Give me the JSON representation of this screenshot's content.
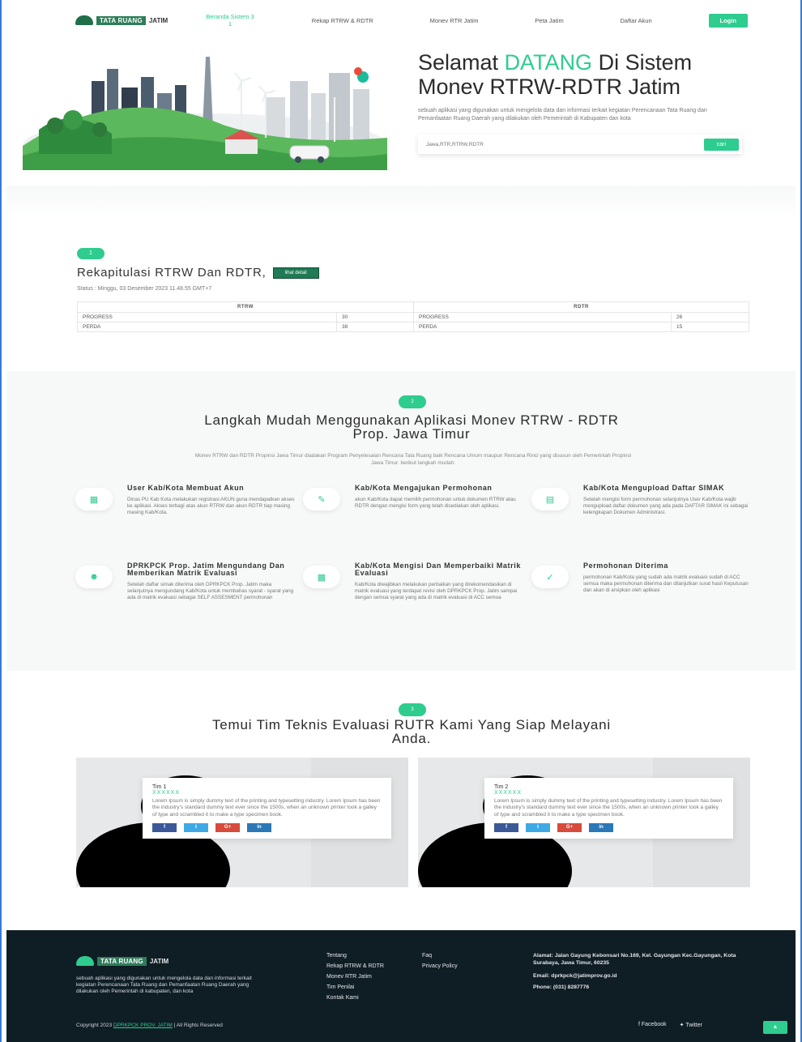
{
  "nav": {
    "logo_text": "TATA RUANG",
    "logo_sub": "JATIM",
    "links": [
      {
        "label": "Beranda Sistem 3 1",
        "active": true
      },
      {
        "label": "Rekap RTRW & RDTR",
        "active": false
      },
      {
        "label": "Monev RTR Jatim",
        "active": false
      },
      {
        "label": "Peta Jatim",
        "active": false
      },
      {
        "label": "Daftar Akun",
        "active": false
      }
    ],
    "login": "Login"
  },
  "hero": {
    "title_pre": "Selamat ",
    "title_accent": "DATANG",
    "title_post": " Di Sistem Monev RTRW-RDTR Jatim",
    "desc": "sebuah aplikasi yang digunakan untuk mengelola data dan informasi terkait kegiatan Perencanaan Tata Ruang dan Pemanfaatan Ruang Daerah yang dilakukan oleh Pemerintah di Kabupaten dan kota",
    "search_placeholder": "Jawa,RTR,RTRW,RDTR",
    "search_button": "cari"
  },
  "rekap": {
    "pill": "1",
    "title": "Rekapitulasi RTRW Dan RDTR,",
    "detail_button": "lihat detail",
    "status": "Status : Minggu, 03 Desember 2023 11.48.55 GMT+7",
    "col_rtrw": "RTRW",
    "col_rdtr": "RDTR",
    "rows": [
      {
        "label_l": "PROGRESS",
        "val_l": "30",
        "label_r": "PROGRESS",
        "val_r": "26"
      },
      {
        "label_l": "PERDA",
        "val_l": "38",
        "label_r": "PERDA",
        "val_r": "15"
      }
    ]
  },
  "langkah": {
    "pill": "2",
    "title": "Langkah Mudah Menggunakan Aplikasi Monev RTRW - RDTR Prop. Jawa Timur",
    "desc": "Monev RTRW dan RDTR Propinsi Jawa Timur diadakan Program Penyelesaian Rencana Tata Ruang baik Rencana Umum maupun Rencana Rinci yang disusun oleh Pemerintah Propinsi Jawa Timur. berikut langkah mudah:",
    "steps": [
      {
        "icon": "user-icon",
        "title": "User Kab/Kota Membuat Akun",
        "desc": "Dinas PU Kab Kota melakukan registrasi AKUN guna mendapatkan akses ke aplikasi. Akses terbagi atas akun RTRW dan akun RDTR tiap masing masing Kab/Kota."
      },
      {
        "icon": "document-icon",
        "title": "Kab/Kota Mengajukan Permohonan",
        "desc": "akun Kab/Kota dapat memilih permohonan untuk dokumen RTRW atau RDTR dengan mengisi form yang telah disediakan oleh aplikasi."
      },
      {
        "icon": "upload-icon",
        "title": "Kab/Kota Mengupload Daftar SIMAK",
        "desc": "Setelah mengisi form permohonan selanjutnya User Kab/Kota wajib mengupload daftar dokumen yang ada pada DAFTAR SIMAK ini sebagai kelengkapan Dokumen Administrasi."
      },
      {
        "icon": "people-icon",
        "title": "DPRKPCK Prop. Jatim Mengundang Dan Memberikan Matrik Evaluasi",
        "desc": "Setelah daftar simak diterima oleh DPRKPCK Prop. Jatim maka selanjutnya mengundang Kab/Kota untuk membahas syarat - syarat yang ada di matrik evaluasi sebagai SELF ASSESMENT permohonan"
      },
      {
        "icon": "form-icon",
        "title": "Kab/Kota Mengisi Dan Memperbaiki Matrik Evaluasi",
        "desc": "Kab/Kota diwajibkan melakukan perbaikan yang direkomendasikan di matrik evaluasi yang terdapat revisi oleh DPRKPCK Prop. Jatim sampai dengan semua syarat yang ada di matrik evaluasi di ACC semua"
      },
      {
        "icon": "check-icon",
        "title": "Permohonan Diterima",
        "desc": "permohonan Kab/Kota yang sudah ada matrik evaluasi sudah di ACC semua maka permohonan diterima dan dilanjutkan surat hasil Keputusan dan akan di arsipkan oleh aplikasi"
      }
    ]
  },
  "team": {
    "pill": "3",
    "title": "Temui Tim Teknis Evaluasi RUTR Kami Yang Siap Melayani Anda.",
    "members": [
      {
        "name": "Tim 1",
        "sub": "XXXXXX",
        "desc": "Lorem Ipsum is simply dummy text of the printing and typesetting industry. Lorem Ipsum has been the industry's standard dummy text ever since the 1500s, when an unknown printer took a galley of type and scrambled it to make a type specimen book."
      },
      {
        "name": "Tim 2",
        "sub": "XXXXXX",
        "desc": "Lorem Ipsum is simply dummy text of the printing and typesetting industry. Lorem Ipsum has been the industry's standard dummy text ever since the 1500s, when an unknown printer took a galley of type and scrambled it to make a type specimen book."
      }
    ],
    "social": [
      {
        "label": "f",
        "color": "#3b5998"
      },
      {
        "label": "t",
        "color": "#3fa9e6"
      },
      {
        "label": "G+",
        "color": "#d64b3c"
      },
      {
        "label": "in",
        "color": "#2b78b6"
      }
    ]
  },
  "footer": {
    "logo_text": "TATA RUANG",
    "logo_sub": "JATIM",
    "desc": "sebuah aplikasi yang digunakan untuk mengelola data dan informasi terkait kegiatan Perencanaan Tata Ruang dan Pemanfaatan Ruang Daerah yang dilakukan oleh Pemerintah di kabupaten, dan kota",
    "col1": [
      "Tentang",
      "Rekap RTRW & RDTR",
      "Monev RTR Jatim",
      "Tim Penilai",
      "Kontak Kami"
    ],
    "col2": [
      "Faq",
      "Privacy Policy"
    ],
    "address": "Alamat: Jalan Gayung Kebonsari No.169, Kel. Gayungan Kec.Gayungan, Kota Surabaya, Jawa Timur, 60235",
    "email": "Email: dprkpck@jatimprov.go.id",
    "phone": "Phone: (031) 8287776",
    "copy_pre": "Copyright 2023 ",
    "copy_hl": "DPRKPCK PROV. JATIM",
    "copy_post": " | All Rights Reserved",
    "facebook": "Facebook",
    "twitter": "Twitter",
    "to_top": "▲"
  }
}
